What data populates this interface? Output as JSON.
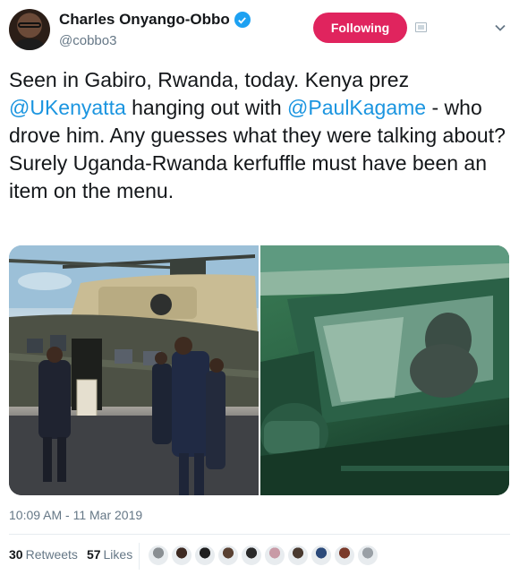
{
  "author": {
    "display_name": "Charles Onyango-Obbo",
    "handle": "@cobbo3"
  },
  "follow_button": {
    "label": "Following"
  },
  "tweet": {
    "t1": "Seen in Gabiro, Rwanda, today. Kenya prez ",
    "mention1": "@UKenyatta",
    "t2": "  hanging out with ",
    "mention2": "@PaulKagame",
    "t3": " - who drove him. Any guesses what they were talking about? Surely Uganda-Rwanda kerfuffle must have been an item on the menu."
  },
  "timestamp": "10:09 AM - 11 Mar 2019",
  "stats": {
    "retweets_count": "30",
    "retweets_label": "Retweets",
    "likes_count": "57",
    "likes_label": "Likes"
  },
  "colors": {
    "accent": "#1b95e0",
    "following_button": "#e0245e",
    "verified_badge": "#1da1f2"
  },
  "liker_avatars": [
    "#8a8f93",
    "#3d2a22",
    "#1f1f1f",
    "#5a4233",
    "#2a2a2a",
    "#c89aa6",
    "#4a3a30",
    "#2c4a7a",
    "#7a3a2a",
    "#9aa0a6"
  ]
}
